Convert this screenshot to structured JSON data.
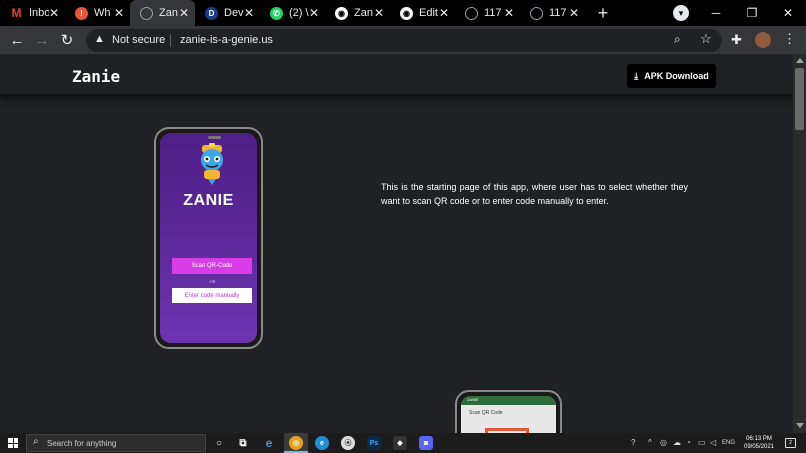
{
  "browser": {
    "tabs": [
      {
        "icon": "gmail-icon",
        "title": "Inbox",
        "badge_color": "#ea4335",
        "active": false
      },
      {
        "icon": "warning-icon",
        "title": "Wh",
        "badge_color": "#e8553b",
        "active": false
      },
      {
        "icon": "globe-icon",
        "title": "Zan",
        "badge_color": "#9aa0a6",
        "active": true
      },
      {
        "icon": "dev-icon",
        "title": "Dev",
        "badge_color": "#1a3b8c",
        "active": false
      },
      {
        "icon": "whatsapp-icon",
        "title": "(2) \\",
        "badge_color": "#25d366",
        "active": false
      },
      {
        "icon": "github-icon",
        "title": "Zan",
        "badge_color": "#ffffff",
        "active": false
      },
      {
        "icon": "github-icon",
        "title": "Edit",
        "badge_color": "#ffffff",
        "active": false
      },
      {
        "icon": "globe-icon",
        "title": "117",
        "badge_color": "#9aa0a6",
        "active": false
      },
      {
        "icon": "globe-icon",
        "title": "117",
        "badge_color": "#9aa0a6",
        "active": false
      }
    ],
    "new_tab": "+",
    "security_label": "Not secure",
    "url": "zanie-is-a-genie.us"
  },
  "site": {
    "brand": "Zanie",
    "apk_button": "APK Download",
    "phone": {
      "app_name": "ZANIE",
      "scan_button": "Scan QR-Code",
      "or_text": "OR",
      "code_button": "Enter code manually"
    },
    "description": "This is the starting page of this app, where user has to select whether they want to scan QR code or to enter code manually to enter.",
    "phone2": {
      "status_text": "ZANIE",
      "label": "Scan QR Code"
    }
  },
  "taskbar": {
    "search_placeholder": "Search for anything",
    "lang": "ENG",
    "time": "06:13 PM",
    "date": "09/05/2021",
    "notification_count": "2"
  },
  "colors": {
    "accent_pink": "#d93ce6",
    "screen_purple": "#5f2a9e"
  }
}
